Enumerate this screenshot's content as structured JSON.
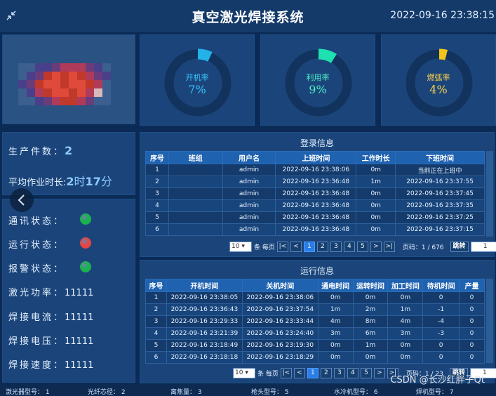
{
  "header": {
    "title": "真空激光焊接系统",
    "datetime": "2022-09-16 23:38:15"
  },
  "gauges": [
    {
      "label": "开机率",
      "value": "7%",
      "percent": 7,
      "color": "#23b2e8",
      "val_color": "#39c6ff"
    },
    {
      "label": "利用率",
      "value": "9%",
      "percent": 9,
      "color": "#1fe0b0",
      "val_color": "#4ff0c8"
    },
    {
      "label": "燃弧率",
      "value": "4%",
      "percent": 4,
      "color": "#f0c419",
      "val_color": "#ffd34a"
    }
  ],
  "production": {
    "count_label": "生产件数：",
    "count": "2",
    "avg_label": "平均作业时长:",
    "avg_h": "2",
    "avg_h_unit": "时",
    "avg_m": "17",
    "avg_m_unit": "分"
  },
  "status": [
    {
      "label": "通讯状态：",
      "color": "#19b44e"
    },
    {
      "label": "运行状态：",
      "color": "#e64545"
    },
    {
      "label": "报警状态：",
      "color": "#19b44e"
    }
  ],
  "params": [
    {
      "label": "激光功率：",
      "value": "11111"
    },
    {
      "label": "焊接电流：",
      "value": "11111"
    },
    {
      "label": "焊接电压：",
      "value": "11111"
    },
    {
      "label": "焊接速度：",
      "value": "11111"
    }
  ],
  "login": {
    "title": "登录信息",
    "columns": [
      "序号",
      "班组",
      "用户名",
      "上班时间",
      "工作时长",
      "下班时间"
    ],
    "rows": [
      [
        "1",
        "",
        "admin",
        "2022-09-16 23:38:06",
        "0m",
        "当前正在上班中"
      ],
      [
        "2",
        "",
        "admin",
        "2022-09-16 23:36:48",
        "1m",
        "2022-09-16 23:37:55"
      ],
      [
        "3",
        "",
        "admin",
        "2022-09-16 23:36:48",
        "0m",
        "2022-09-16 23:37:45"
      ],
      [
        "4",
        "",
        "admin",
        "2022-09-16 23:36:48",
        "0m",
        "2022-09-16 23:37:35"
      ],
      [
        "5",
        "",
        "admin",
        "2022-09-16 23:36:48",
        "0m",
        "2022-09-16 23:37:25"
      ],
      [
        "6",
        "",
        "admin",
        "2022-09-16 23:36:48",
        "0m",
        "2022-09-16 23:37:15"
      ]
    ],
    "pager": {
      "page_size": "10",
      "per_page_label": "条 每页",
      "first": "|<",
      "prev": "<",
      "pages": [
        "1",
        "2",
        "3",
        "4",
        "5"
      ],
      "next": ">",
      "last": ">|",
      "page_info": "页码：1 / 676",
      "jump": "跳转",
      "jump_value": "1"
    }
  },
  "run": {
    "title": "运行信息",
    "columns": [
      "序号",
      "开机时间",
      "关机时间",
      "通电时间",
      "运转时间",
      "加工时间",
      "待机时间",
      "产量"
    ],
    "rows": [
      [
        "1",
        "2022-09-16 23:38:05",
        "2022-09-16 23:38:06",
        "0m",
        "0m",
        "0m",
        "0",
        "0"
      ],
      [
        "2",
        "2022-09-16 23:36:43",
        "2022-09-16 23:37:54",
        "1m",
        "2m",
        "1m",
        "-1",
        "0"
      ],
      [
        "3",
        "2022-09-16 23:29:33",
        "2022-09-16 23:33:44",
        "4m",
        "8m",
        "4m",
        "-4",
        "0"
      ],
      [
        "4",
        "2022-09-16 23:21:39",
        "2022-09-16 23:24:40",
        "3m",
        "6m",
        "3m",
        "-3",
        "0"
      ],
      [
        "5",
        "2022-09-16 23:18:49",
        "2022-09-16 23:19:30",
        "0m",
        "1m",
        "0m",
        "0",
        "0"
      ],
      [
        "6",
        "2022-09-16 23:18:18",
        "2022-09-16 23:18:29",
        "0m",
        "0m",
        "0m",
        "0",
        "0"
      ]
    ],
    "pager": {
      "page_size": "10",
      "per_page_label": "条 每页",
      "first": "|<",
      "prev": "<",
      "pages": [
        "1",
        "2",
        "3",
        "4",
        "5"
      ],
      "next": ">",
      "last": ">|",
      "page_info": "页码：1 / 23",
      "jump": "跳转",
      "jump_value": "1"
    }
  },
  "footer": [
    {
      "label": "激光器型号：",
      "value": "1"
    },
    {
      "label": "光纤芯径：",
      "value": "2"
    },
    {
      "label": "离焦量：",
      "value": "3"
    },
    {
      "label": "枪头型号：",
      "value": "5"
    },
    {
      "label": "水冷机型号：",
      "value": "6"
    },
    {
      "label": "焊机型号：",
      "value": "7"
    }
  ],
  "watermark": "CSDN @长沙红胖子Qt",
  "icons": {
    "shrink": "shrink-arrows-icon",
    "back": "chevron-left-icon"
  }
}
